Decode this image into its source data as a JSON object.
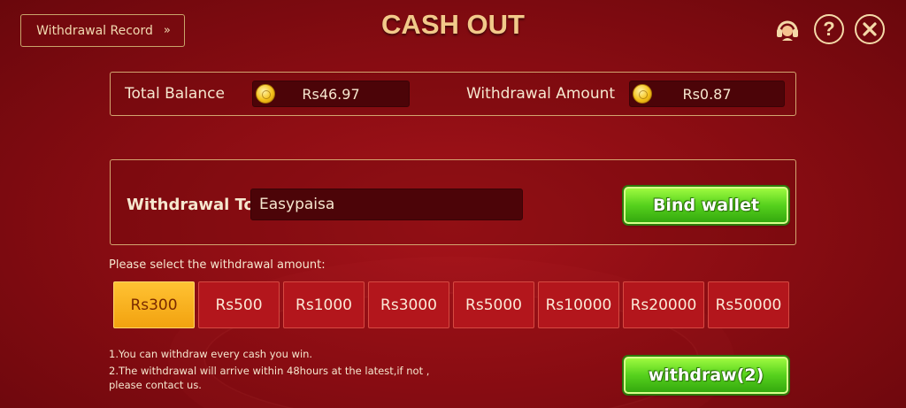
{
  "header": {
    "record_button": "Withdrawal Record",
    "record_chevron": "»",
    "title": "CASH OUT",
    "help_glyph": "?"
  },
  "balance": {
    "total_label": "Total Balance",
    "total_value": "Rs46.97",
    "withdraw_label": "Withdrawal Amount",
    "withdraw_value": "Rs0.87"
  },
  "withdrawal": {
    "label": "Withdrawal To",
    "method": "Easypaisa",
    "bind_button": "Bind wallet"
  },
  "amounts": {
    "prompt": "Please select the withdrawal amount:",
    "options": [
      "Rs300",
      "Rs500",
      "Rs1000",
      "Rs3000",
      "Rs5000",
      "Rs10000",
      "Rs20000",
      "Rs50000"
    ],
    "selected_index": 0
  },
  "notes": [
    "1.You can withdraw every cash you win.",
    "2.The withdrawal will arrive within 48hours at the latest,if not ,",
    "please contact us."
  ],
  "withdraw_button": "withdraw(2)",
  "icons": {
    "support": "headset-icon",
    "help": "question-icon",
    "close": "close-icon",
    "coin": "coin-icon"
  },
  "colors": {
    "background": "#8c0d13",
    "title": "#f2c98a",
    "selected_amount": "#f2a20f",
    "green_button": "#56d11d"
  }
}
